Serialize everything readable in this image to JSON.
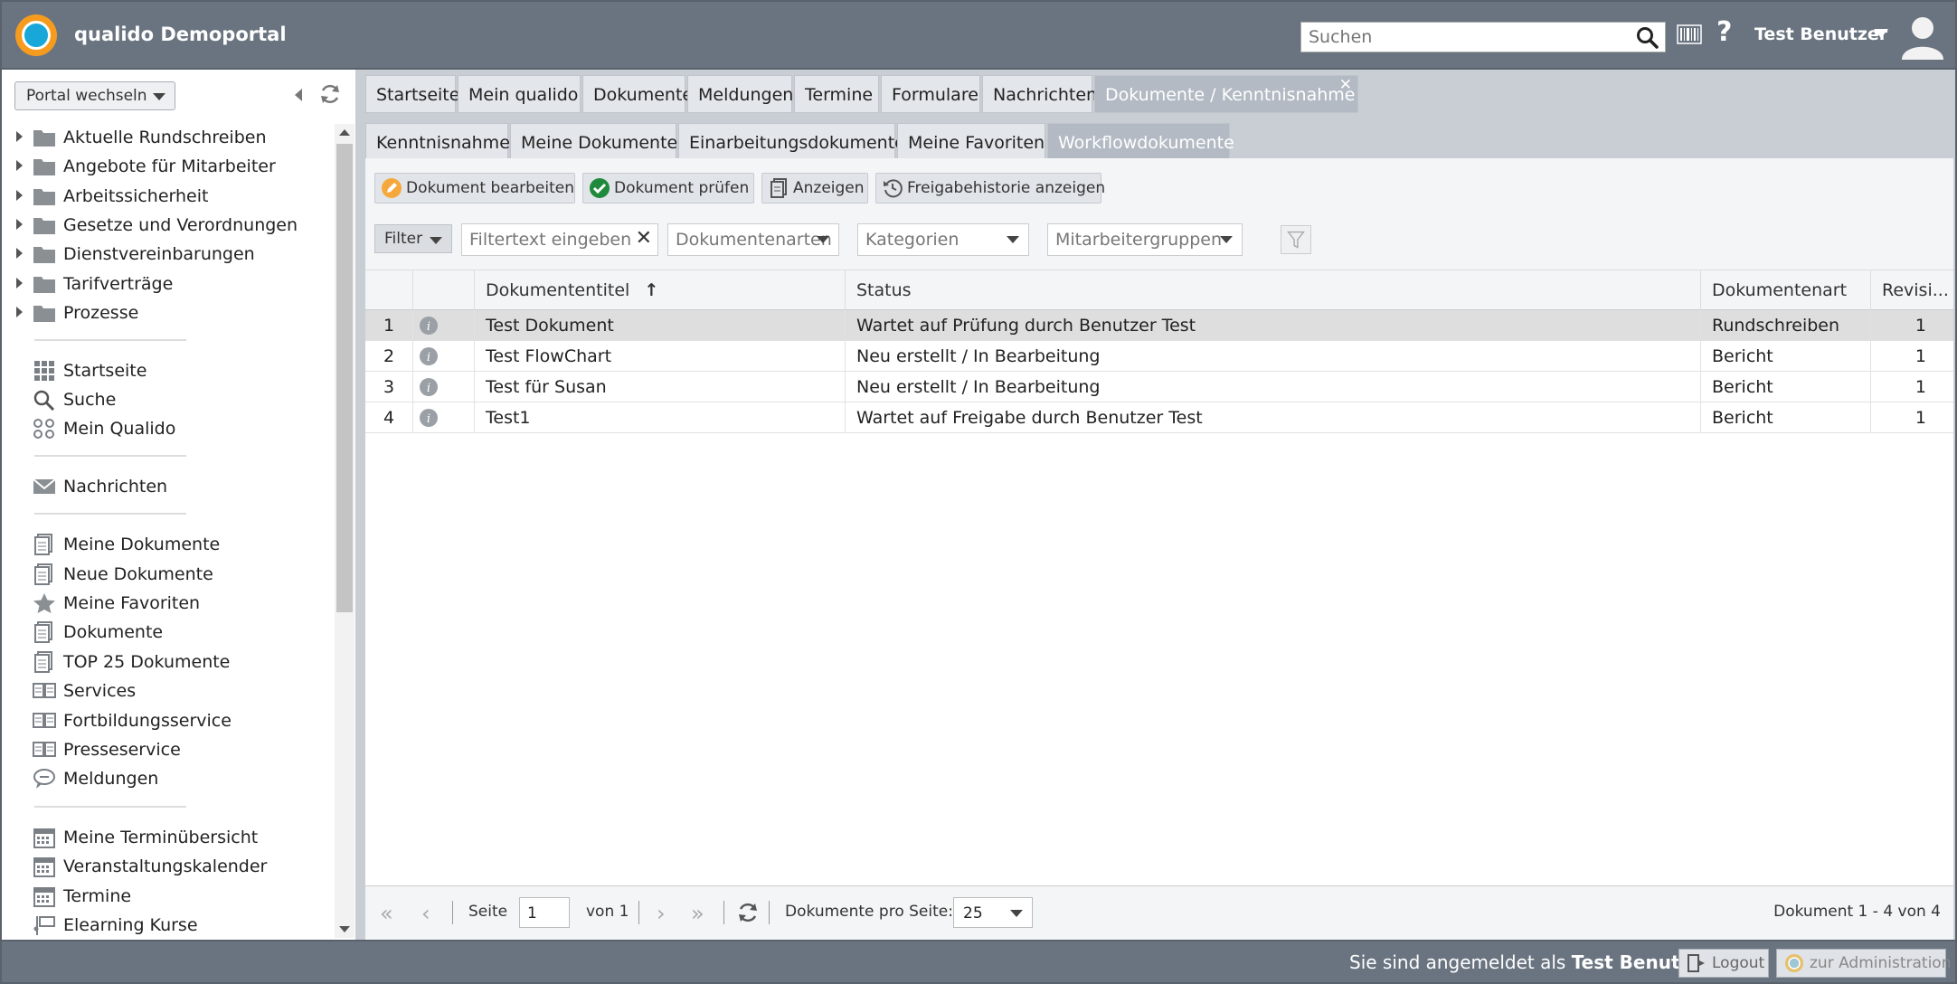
{
  "header": {
    "title": "qualido Demoportal",
    "search_placeholder": "Suchen",
    "user": "Test Benutzer",
    "help": "?"
  },
  "sidebar": {
    "portal_switch": "Portal wechseln",
    "folders": [
      "Aktuelle Rundschreiben",
      "Angebote für Mitarbeiter",
      "Arbeitssicherheit",
      "Gesetze und Verordnungen",
      "Dienstvereinbarungen",
      "Tarifverträge",
      "Prozesse"
    ],
    "nav1": [
      "Startseite",
      "Suche",
      "Mein Qualido"
    ],
    "nav2": [
      "Nachrichten"
    ],
    "nav3": [
      "Meine Dokumente",
      "Neue Dokumente",
      "Meine Favoriten",
      "Dokumente",
      "TOP 25 Dokumente",
      "Services",
      "Fortbildungsservice",
      "Presseservice",
      "Meldungen"
    ],
    "nav4": [
      "Meine Terminübersicht",
      "Veranstaltungskalender",
      "Termine",
      "Elearning Kurse"
    ]
  },
  "tabs_main": [
    "Startseite",
    "Mein qualido",
    "Dokumente",
    "Meldungen",
    "Termine",
    "Formulare",
    "Nachrichten",
    "Dokumente / Kenntnisnahme"
  ],
  "tabs_sub": [
    "Kenntnisnahme",
    "Meine Dokumente",
    "Einarbeitungsdokumente",
    "Meine Favoriten",
    "Workflowdokumente"
  ],
  "toolbar": {
    "edit": "Dokument bearbeiten",
    "check": "Dokument prüfen",
    "show": "Anzeigen",
    "history": "Freigabehistorie anzeigen"
  },
  "filter": {
    "filter_btn": "Filter",
    "text_placeholder": "Filtertext eingeben",
    "doctype": "Dokumentenarten",
    "categories": "Kategorien",
    "groups": "Mitarbeitergruppen"
  },
  "grid": {
    "headers": [
      "Dokumententitel",
      "Status",
      "Dokumentenart",
      "Revisi..."
    ],
    "rows": [
      {
        "n": "1",
        "title": "Test Dokument",
        "status": "Wartet auf Prüfung durch Benutzer Test",
        "type": "Rundschreiben",
        "rev": "1"
      },
      {
        "n": "2",
        "title": "Test FlowChart",
        "status": "Neu erstellt / In Bearbeitung",
        "type": "Bericht",
        "rev": "1"
      },
      {
        "n": "3",
        "title": "Test für Susan",
        "status": "Neu erstellt / In Bearbeitung",
        "type": "Bericht",
        "rev": "1"
      },
      {
        "n": "4",
        "title": "Test1",
        "status": "Wartet auf Freigabe durch Benutzer Test",
        "type": "Bericht",
        "rev": "1"
      }
    ]
  },
  "pager": {
    "page_label": "Seite",
    "page": "1",
    "of": "von 1",
    "per_page_label": "Dokumente pro Seite:",
    "per_page": "25",
    "summary": "Dokument 1 - 4 von 4"
  },
  "footer": {
    "logged_in_prefix": "Sie sind angemeldet als ",
    "logged_in_user": "Test Benutzer",
    "logout": "Logout",
    "admin": "zur Administration"
  }
}
